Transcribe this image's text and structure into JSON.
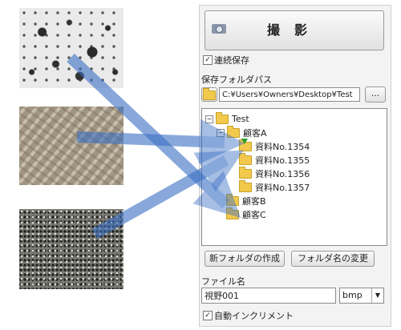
{
  "panel": {
    "shoot_button": "撮影",
    "continuous_save": {
      "label": "連続保存",
      "checked": true
    },
    "save_folder_label": "保存フォルダパス",
    "save_path": "C:¥Users¥Owners¥Desktop¥Test",
    "browse_label": "...",
    "tree": {
      "root": "Test",
      "customer_a": "顧客A",
      "docs": [
        "資料No.1354",
        "資料No.1355",
        "資料No.1356",
        "資料No.1357"
      ],
      "customer_b": "顧客B",
      "customer_c": "顧客C"
    },
    "new_folder_button": "新フォルダの作成",
    "rename_folder_button": "フォルダ名の変更",
    "filename_label": "ファイル名",
    "filename_value": "視野001",
    "extension": "bmp",
    "auto_increment": {
      "label": "自動インクリメント",
      "checked": true
    }
  },
  "colors": {
    "arrow": "#3a6fc4",
    "folder": "#f2c94c"
  }
}
